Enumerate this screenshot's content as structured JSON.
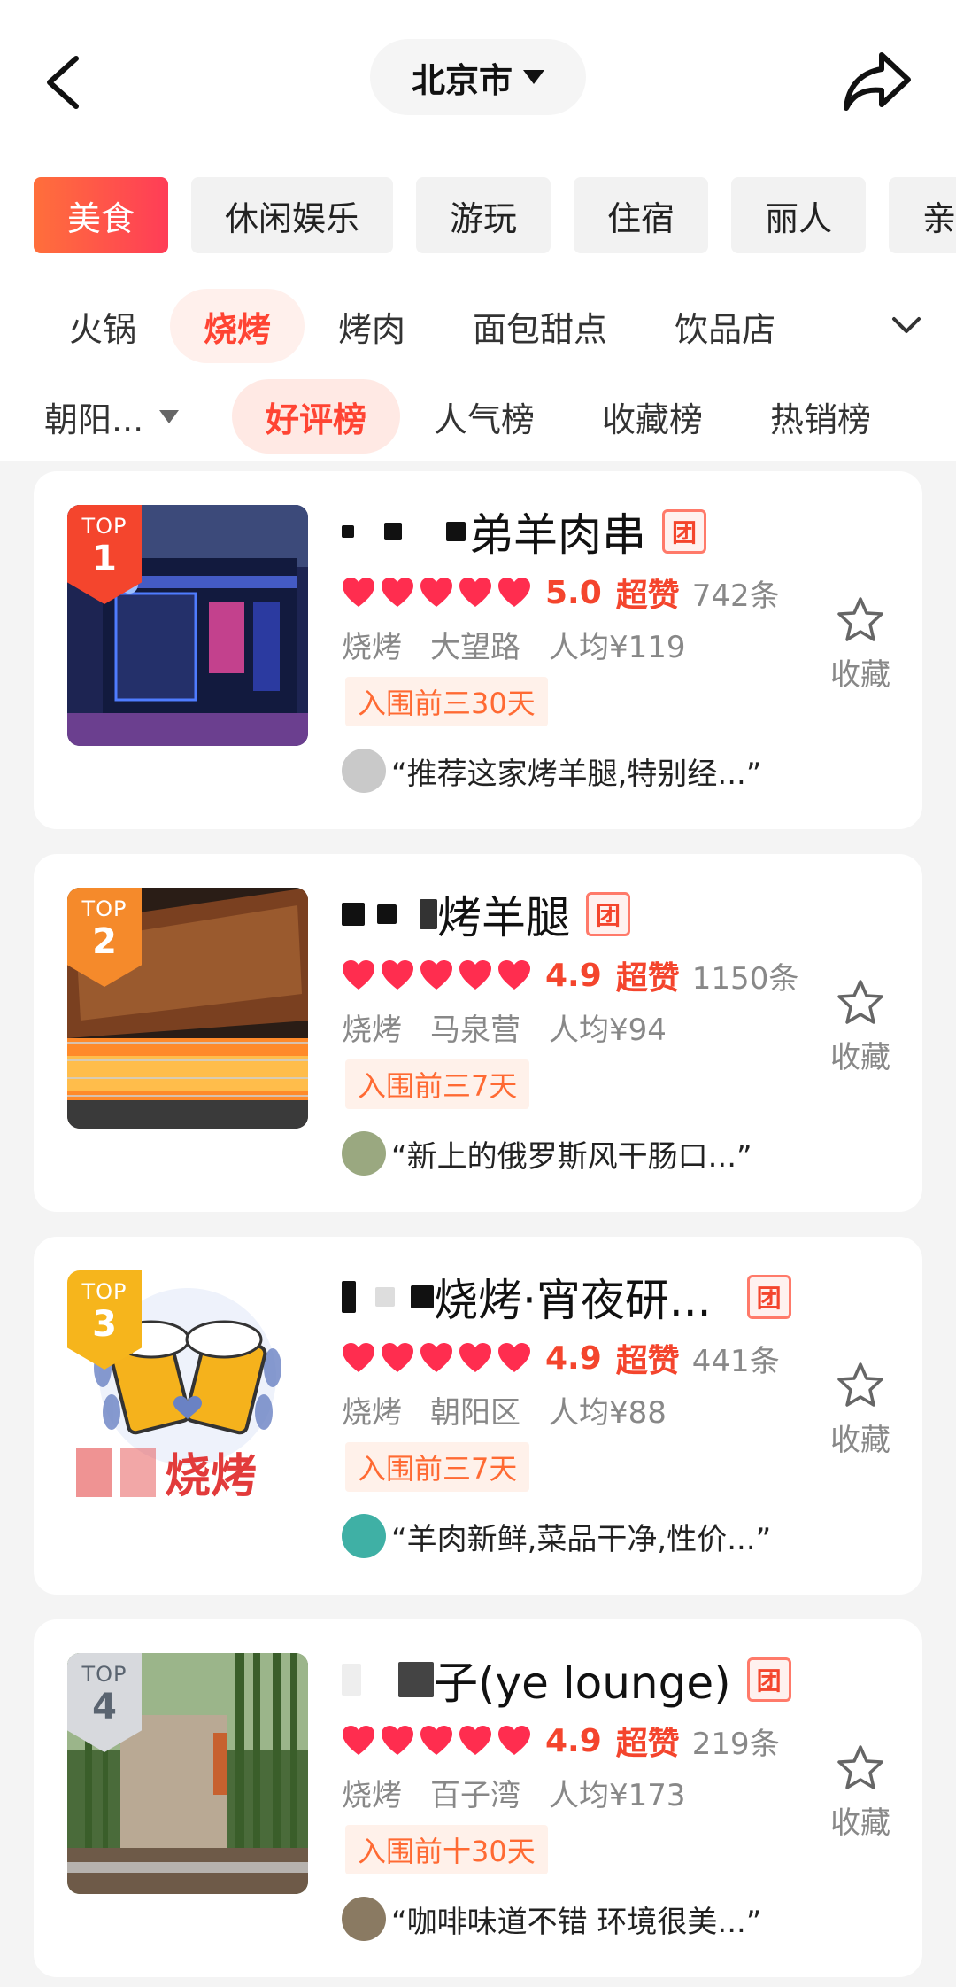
{
  "header": {
    "city": "北京市",
    "icons": {
      "back": "back-arrow-icon",
      "share": "share-arrow-icon",
      "city": "caret-down-icon"
    }
  },
  "categories": [
    {
      "label": "美食",
      "active": true
    },
    {
      "label": "休闲娱乐",
      "active": false
    },
    {
      "label": "游玩",
      "active": false
    },
    {
      "label": "住宿",
      "active": false
    },
    {
      "label": "丽人",
      "active": false
    },
    {
      "label": "亲",
      "active": false
    }
  ],
  "subcategories": [
    {
      "label": "火锅",
      "active": false
    },
    {
      "label": "烧烤",
      "active": true
    },
    {
      "label": "烤肉",
      "active": false
    },
    {
      "label": "面包甜点",
      "active": false
    },
    {
      "label": "饮品店",
      "active": false
    }
  ],
  "filters": {
    "area": "朝阳...",
    "rank_tabs": [
      {
        "label": "好评榜",
        "active": true
      },
      {
        "label": "人气榜",
        "active": false
      },
      {
        "label": "收藏榜",
        "active": false
      },
      {
        "label": "热销榜",
        "active": false
      }
    ]
  },
  "colors": {
    "accent": "#f4452d",
    "tag_bg": "#fff1ea",
    "tag_text": "#ff6a33"
  },
  "shops": [
    {
      "rank_label": "TOP",
      "rank": "1",
      "name": "弟羊肉串",
      "group_badge": "团",
      "score": "5.0",
      "praise": "超赞",
      "reviews": "742条",
      "category": "烧烤",
      "district": "大望路",
      "avg_price": "人均¥119",
      "tag": "入围前三30天",
      "review": "“推荐这家烤羊腿,特别经...”",
      "favorite_label": "收藏"
    },
    {
      "rank_label": "TOP",
      "rank": "2",
      "name": "烤羊腿",
      "group_badge": "团",
      "score": "4.9",
      "praise": "超赞",
      "reviews": "1150条",
      "category": "烧烤",
      "district": "马泉营",
      "avg_price": "人均¥94",
      "tag": "入围前三7天",
      "review": "“新上的俄罗斯风干肠口...”",
      "favorite_label": "收藏"
    },
    {
      "rank_label": "TOP",
      "rank": "3",
      "name": "烧烤·宵夜研...",
      "group_badge": "团",
      "score": "4.9",
      "praise": "超赞",
      "reviews": "441条",
      "category": "烧烤",
      "district": "朝阳区",
      "avg_price": "人均¥88",
      "tag": "入围前三7天",
      "review": "“羊肉新鲜,菜品干净,性价...”",
      "favorite_label": "收藏",
      "thumb_text": "烧烤"
    },
    {
      "rank_label": "TOP",
      "rank": "4",
      "name": "子(ye lounge)",
      "group_badge": "团",
      "score": "4.9",
      "praise": "超赞",
      "reviews": "219条",
      "category": "烧烤",
      "district": "百子湾",
      "avg_price": "人均¥173",
      "tag": "入围前十30天",
      "review": "“咖啡味道不错 环境很美...”",
      "favorite_label": "收藏"
    }
  ]
}
